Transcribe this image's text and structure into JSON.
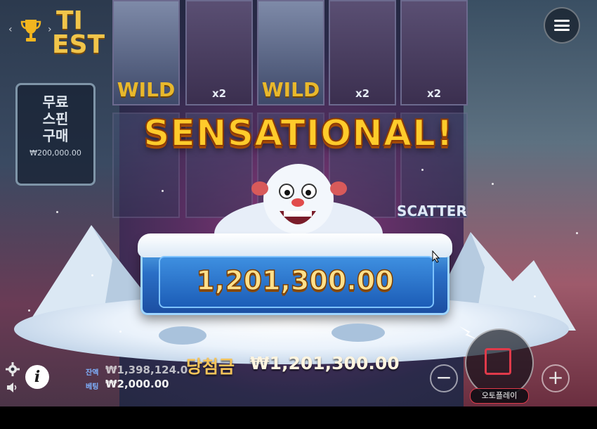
{
  "game": {
    "logo_text_1": "TI",
    "logo_text_2": "EST"
  },
  "buy_panel": {
    "line1": "무료",
    "line2": "스핀",
    "line3": "구매",
    "price": "₩200,000.00"
  },
  "reels": {
    "top_row": [
      {
        "symbol": "yeti-wild",
        "label": "WILD"
      },
      {
        "symbol": "hero",
        "label": "x2"
      },
      {
        "symbol": "yeti-wild",
        "label": "WILD"
      },
      {
        "symbol": "hero",
        "label": "x2"
      },
      {
        "symbol": "hero",
        "label": "x2"
      }
    ],
    "scatter_label": "SCATTER"
  },
  "win_banner": {
    "headline": "SENSATIONAL!",
    "amount": "1,201,300.00"
  },
  "footer": {
    "win_label": "당첨금",
    "win_amount": "₩1,201,300.00",
    "balance_label": "잔액",
    "balance_value": "₩1,398,124.0",
    "bet_label": "베팅",
    "bet_value": "₩2,000.00",
    "autoplay_label": "오토플레이",
    "minus": "−",
    "plus": "+",
    "info": "i"
  },
  "colors": {
    "accent_gold": "#ffcb2b",
    "stop_red": "#e03a4a",
    "ice_blue": "#2a6fc6"
  }
}
